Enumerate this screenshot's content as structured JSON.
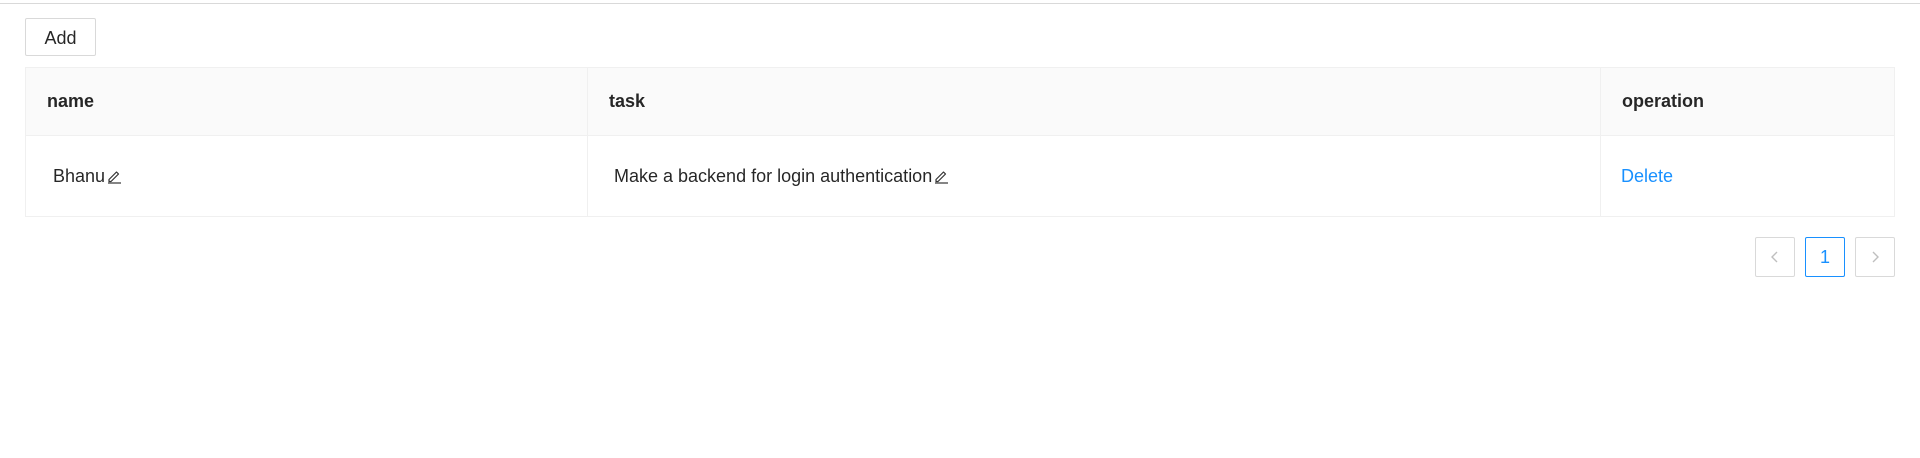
{
  "toolbar": {
    "add_label": "Add"
  },
  "table": {
    "columns": [
      "name",
      "task",
      "operation"
    ],
    "rows": [
      {
        "name": "Bhanu",
        "task": "Make a backend for login authentication",
        "operation": "Delete"
      }
    ]
  },
  "pagination": {
    "prev_icon": "chevron-left-icon",
    "current_page": "1",
    "next_icon": "chevron-right-icon"
  },
  "colors": {
    "accent": "#1890ff",
    "border": "#d9d9d9",
    "header_bg": "#fafafa"
  }
}
